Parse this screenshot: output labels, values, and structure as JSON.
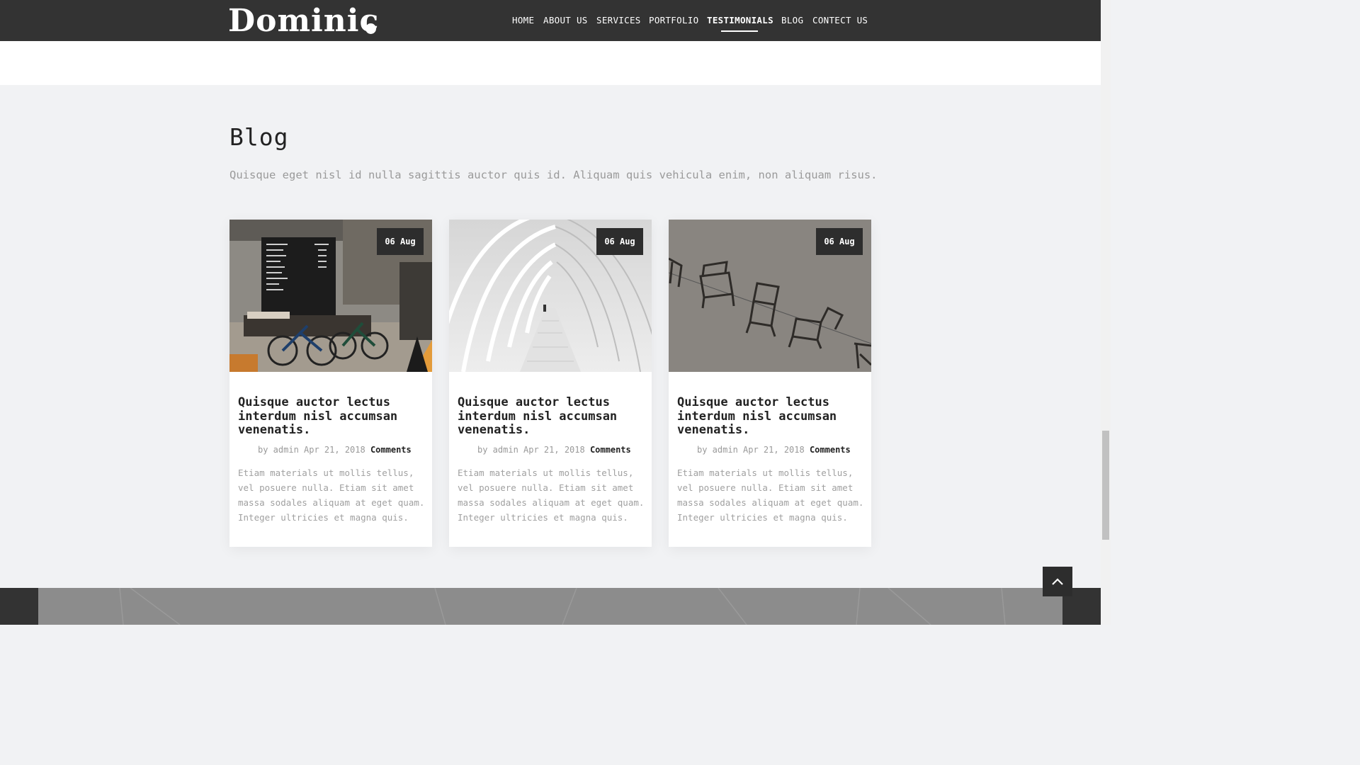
{
  "header": {
    "logo": "Dominic",
    "nav": [
      {
        "label": "HOME",
        "active": false
      },
      {
        "label": "ABOUT US",
        "active": false
      },
      {
        "label": "SERVICES",
        "active": false
      },
      {
        "label": "PORTFOLIO",
        "active": false
      },
      {
        "label": "TESTIMONIALS",
        "active": true
      },
      {
        "label": "BLOG",
        "active": false
      },
      {
        "label": "CONTECT US",
        "active": false
      }
    ]
  },
  "blog": {
    "title": "Blog",
    "subtitle": "Quisque eget nisl id nulla sagittis auctor quis id. Aliquam quis vehicula enim, non aliquam risus.",
    "posts": [
      {
        "image": "cafe-interior-photo",
        "date": "06 Aug",
        "title": "Quisque auctor lectus interdum nisl accumsan venenatis.",
        "meta": "by admin Apr 21, 2018",
        "comments": "Comments",
        "excerpt": "Etiam materials ut mollis tellus, vel posuere nulla. Etiam sit amet massa sodales aliquam at eget quam. Integer ultricies et magna quis."
      },
      {
        "image": "white-corridor-photo",
        "date": "06 Aug",
        "title": "Quisque auctor lectus interdum nisl accumsan venenatis.",
        "meta": "by admin Apr 21, 2018",
        "comments": "Comments",
        "excerpt": "Etiam materials ut mollis tellus, vel posuere nulla. Etiam sit amet massa sodales aliquam at eget quam. Integer ultricies et magna quis."
      },
      {
        "image": "floating-chairs-photo",
        "date": "06 Aug",
        "title": "Quisque auctor lectus interdum nisl accumsan venenatis.",
        "meta": "by admin Apr 21, 2018",
        "comments": "Comments",
        "excerpt": "Etiam materials ut mollis tellus, vel posuere nulla. Etiam sit amet massa sodales aliquam at eget quam. Integer ultricies et magna quis."
      }
    ]
  },
  "back_to_top_icon": "chevron-up-icon",
  "colors": {
    "header_bg": "#333333",
    "page_bg": "#f1f2f4",
    "badge_bg": "#2d2d2d"
  }
}
